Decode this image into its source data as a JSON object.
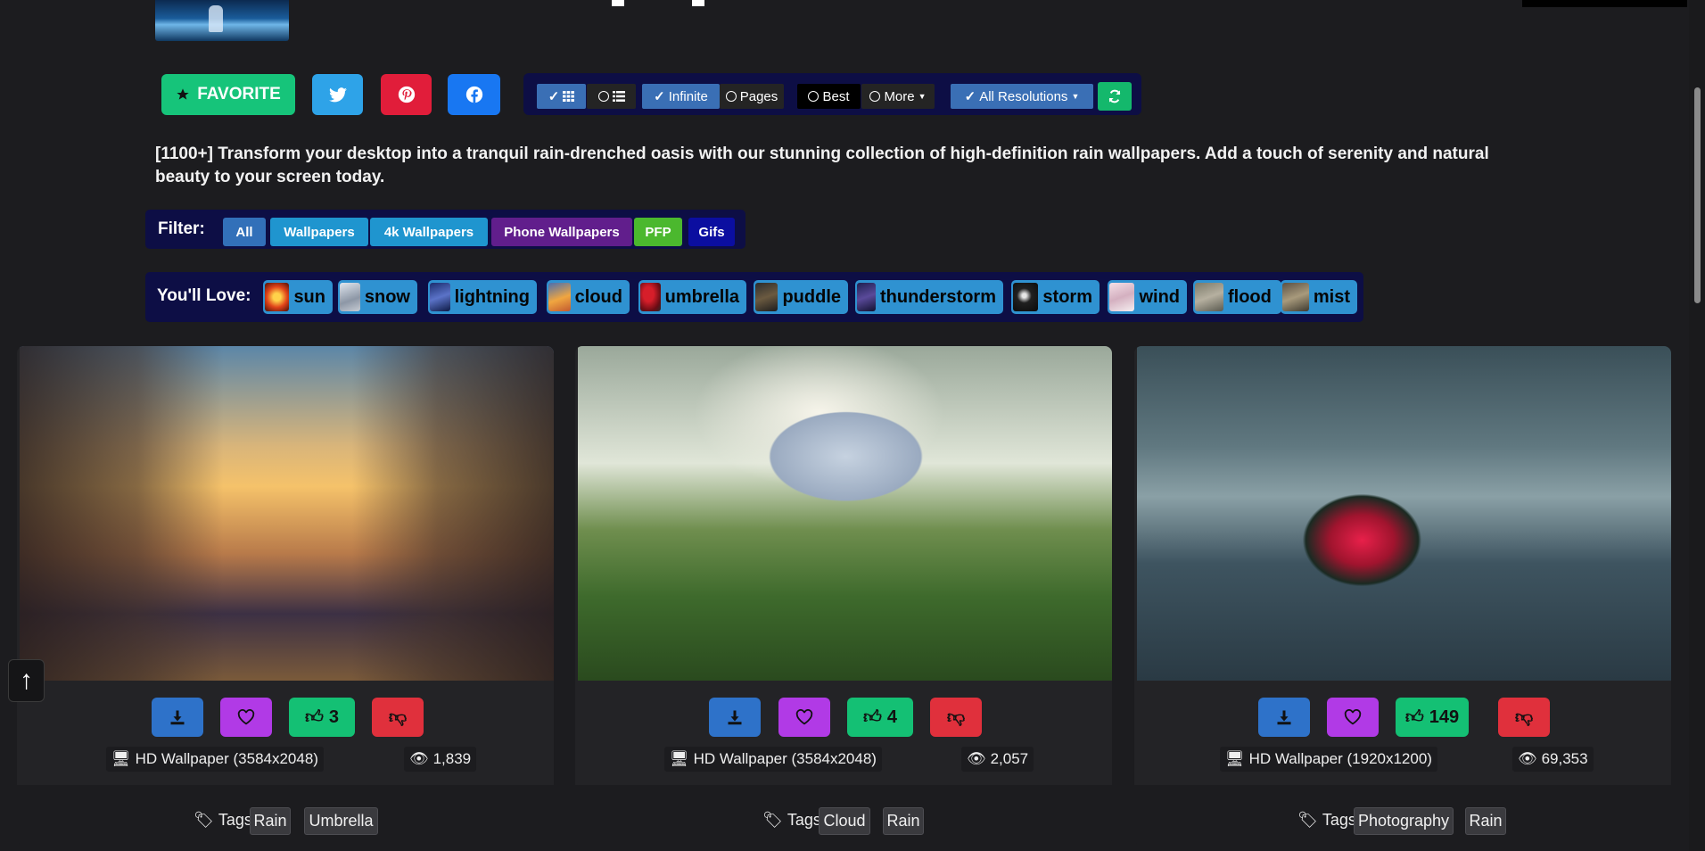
{
  "share": {
    "favorite_label": "FAVORITE"
  },
  "toolbar": {
    "infinite": "Infinite",
    "pages": "Pages",
    "best": "Best",
    "more": "More",
    "resolutions": "All Resolutions"
  },
  "description": "[1100+] Transform your desktop into a tranquil rain-drenched oasis with our stunning collection of high-definition rain wallpapers. Add a touch of serenity and natural beauty to your screen today.",
  "filter": {
    "label": "Filter:",
    "items": [
      "All",
      "Wallpapers",
      "4k Wallpapers",
      "Phone Wallpapers",
      "PFP",
      "Gifs"
    ]
  },
  "love": {
    "label": "You'll Love:",
    "items": [
      "sun",
      "snow",
      "lightning",
      "cloud",
      "umbrella",
      "puddle",
      "thunderstorm",
      "storm",
      "wind",
      "flood",
      "mist"
    ]
  },
  "cards": [
    {
      "likes": "3",
      "resolution": "HD Wallpaper (3584x2048)",
      "views": "1,839",
      "tags_label": "Tags",
      "tags": [
        "Rain",
        "Umbrella"
      ]
    },
    {
      "likes": "4",
      "resolution": "HD Wallpaper (3584x2048)",
      "views": "2,057",
      "tags_label": "Tags",
      "tags": [
        "Cloud",
        "Rain"
      ]
    },
    {
      "likes": "149",
      "resolution": "HD Wallpaper (1920x1200)",
      "views": "69,353",
      "tags_label": "Tags",
      "tags": [
        "Photography",
        "Rain"
      ]
    }
  ],
  "colors": {
    "background": "#1c1c1f",
    "toolbar_bg": "#0d0e45",
    "favorite": "#16c47a",
    "like": "#14c074",
    "dislike": "#e0303c",
    "download": "#2e72c9",
    "heart": "#b13ae6"
  },
  "back_to_top": "↑"
}
